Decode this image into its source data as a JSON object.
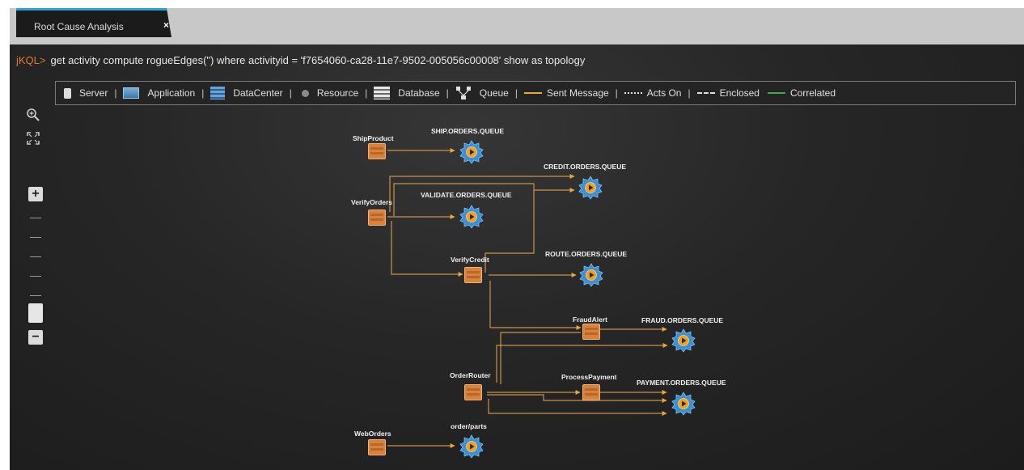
{
  "tab": {
    "title": "Root Cause Analysis",
    "close": "×"
  },
  "command": {
    "prompt": "jKQL>",
    "query": "get activity compute rogueEdges(\") where activityid = 'f7654060-ca28-11e7-9502-005056c00008' show as topology"
  },
  "legend": {
    "items": [
      {
        "label": "Server",
        "icon": "server-icon"
      },
      {
        "label": "Application",
        "icon": "application-icon"
      },
      {
        "label": "DataCenter",
        "icon": "datacenter-icon"
      },
      {
        "label": "Resource",
        "icon": "resource-icon"
      },
      {
        "label": "Database",
        "icon": "database-icon"
      },
      {
        "label": "Queue",
        "icon": "queue-icon"
      }
    ],
    "edges": [
      {
        "label": "Sent Message",
        "color": "#e6a93a",
        "style": "solid"
      },
      {
        "label": "Acts On",
        "color": "#e0e0e0",
        "style": "dotted"
      },
      {
        "label": "Enclosed",
        "color": "#e0e0e0",
        "style": "dashed"
      },
      {
        "label": "Correlated",
        "color": "#3fa84c",
        "style": "solid"
      }
    ],
    "separator": "|"
  },
  "toolbar": {
    "zoom_in": "+",
    "zoom_out": "−"
  },
  "topology": {
    "colors": {
      "edge": "#c89548",
      "server": "#d9823c",
      "queue_outer": "#3b8fd6",
      "queue_inner": "#f0a020"
    },
    "servers": [
      {
        "id": "ship",
        "label": "ShipProduct"
      },
      {
        "id": "verify",
        "label": "VerifyOrders"
      },
      {
        "id": "credit",
        "label": "VerifyCredit"
      },
      {
        "id": "fraud",
        "label": "FraudAlert"
      },
      {
        "id": "router",
        "label": "OrderRouter"
      },
      {
        "id": "payment",
        "label": "ProcessPayment"
      },
      {
        "id": "web",
        "label": "WebOrders"
      }
    ],
    "queues": [
      {
        "id": "q_ship",
        "label": "SHIP.ORDERS.QUEUE"
      },
      {
        "id": "q_credit",
        "label": "CREDIT.ORDERS.QUEUE"
      },
      {
        "id": "q_validate",
        "label": "VALIDATE.ORDERS.QUEUE"
      },
      {
        "id": "q_route",
        "label": "ROUTE.ORDERS.QUEUE"
      },
      {
        "id": "q_fraud",
        "label": "FRAUD.ORDERS.QUEUE"
      },
      {
        "id": "q_payment",
        "label": "PAYMENT.ORDERS.QUEUE"
      },
      {
        "id": "q_web",
        "label": "order/parts"
      }
    ]
  }
}
